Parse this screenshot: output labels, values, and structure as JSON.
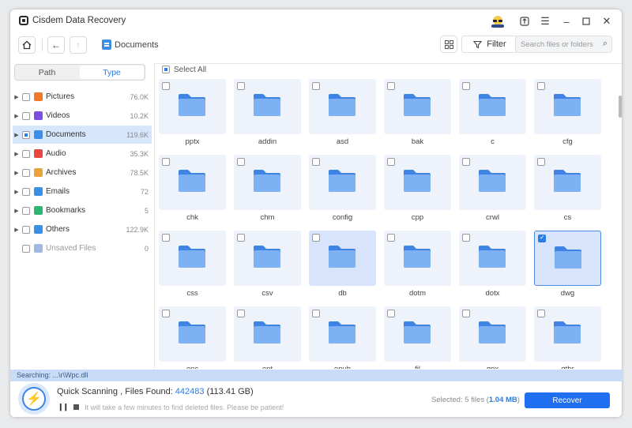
{
  "app": {
    "title": "Cisdem Data Recovery"
  },
  "toolbar": {
    "breadcrumb": "Documents",
    "filter_label": "Filter",
    "search_placeholder": "Search files or folders"
  },
  "sidebar": {
    "tabs": [
      {
        "label": "Path",
        "active": false
      },
      {
        "label": "Type",
        "active": true
      }
    ],
    "items": [
      {
        "label": "Pictures",
        "count": "76.0K",
        "icon": "pictures-icon",
        "color": "#f07a2a"
      },
      {
        "label": "Videos",
        "count": "10.2K",
        "icon": "videos-icon",
        "color": "#7b4fe0"
      },
      {
        "label": "Documents",
        "count": "119.6K",
        "icon": "documents-icon",
        "color": "#3b8ee6"
      },
      {
        "label": "Audio",
        "count": "35.3K",
        "icon": "audio-icon",
        "color": "#e8463e"
      },
      {
        "label": "Archives",
        "count": "78.5K",
        "icon": "archives-icon",
        "color": "#e8a33a"
      },
      {
        "label": "Emails",
        "count": "72",
        "icon": "emails-icon",
        "color": "#3b8ee6"
      },
      {
        "label": "Bookmarks",
        "count": "5",
        "icon": "bookmarks-icon",
        "color": "#2bb673"
      },
      {
        "label": "Others",
        "count": "122.9K",
        "icon": "others-icon",
        "color": "#3b8ee6"
      },
      {
        "label": "Unsaved Files",
        "count": "0",
        "icon": "unsaved-files-icon",
        "color": "#9fb9e0"
      }
    ]
  },
  "main": {
    "select_all": "Select All",
    "folders": [
      "pptx",
      "addin",
      "asd",
      "bak",
      "c",
      "cfg",
      "chk",
      "chm",
      "config",
      "cpp",
      "crwl",
      "cs",
      "css",
      "csv",
      "db",
      "dotm",
      "dotx",
      "dwg",
      "epc",
      "ept",
      "epub",
      "fil",
      "gpx",
      "gthr"
    ],
    "highlighted": "db",
    "checked": "dwg"
  },
  "status": {
    "searching": "Searching: ...\\r\\Wpc.dll",
    "scan_prefix": "Quick Scanning , Files Found: ",
    "files_found": "442483",
    "files_size": " (113.41 GB)",
    "hint": "It will take a few minutes to find deleted files. Please be patient!",
    "selected_prefix": "Selected: 5 files (",
    "selected_size": "1.04 MB",
    "selected_suffix": ")",
    "recover_label": "Recover"
  }
}
